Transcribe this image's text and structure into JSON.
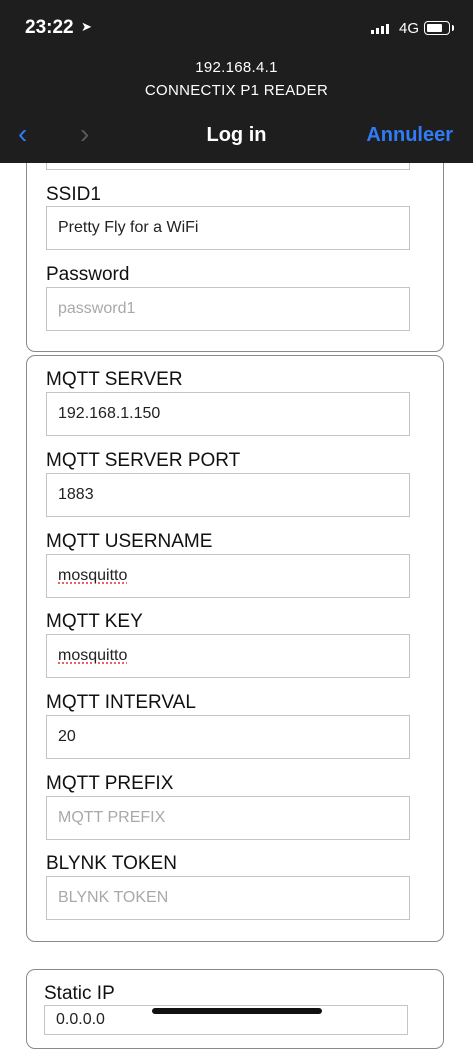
{
  "status_bar": {
    "time": "23:22",
    "network": "4G"
  },
  "browser": {
    "address": "192.168.4.1",
    "page_name": "CONNECTIX P1 READER",
    "title": "Log in",
    "cancel_label": "Annuleer"
  },
  "wifi": {
    "ssid_label": "SSID1",
    "ssid_value": "Pretty Fly for a WiFi",
    "password_label": "Password",
    "password_placeholder": "password1"
  },
  "mqtt": {
    "server_label": "MQTT SERVER",
    "server_value": "192.168.1.150",
    "port_label": "MQTT SERVER PORT",
    "port_value": "1883",
    "username_label": "MQTT USERNAME",
    "username_value": "mosquitto",
    "key_label": "MQTT KEY",
    "key_value": "mosquitto",
    "interval_label": "MQTT INTERVAL",
    "interval_value": "20",
    "prefix_label": "MQTT PREFIX",
    "prefix_placeholder": "MQTT PREFIX",
    "blynk_label": "BLYNK TOKEN",
    "blynk_placeholder": "BLYNK TOKEN"
  },
  "static": {
    "label": "Static IP",
    "value": "0.0.0.0"
  }
}
